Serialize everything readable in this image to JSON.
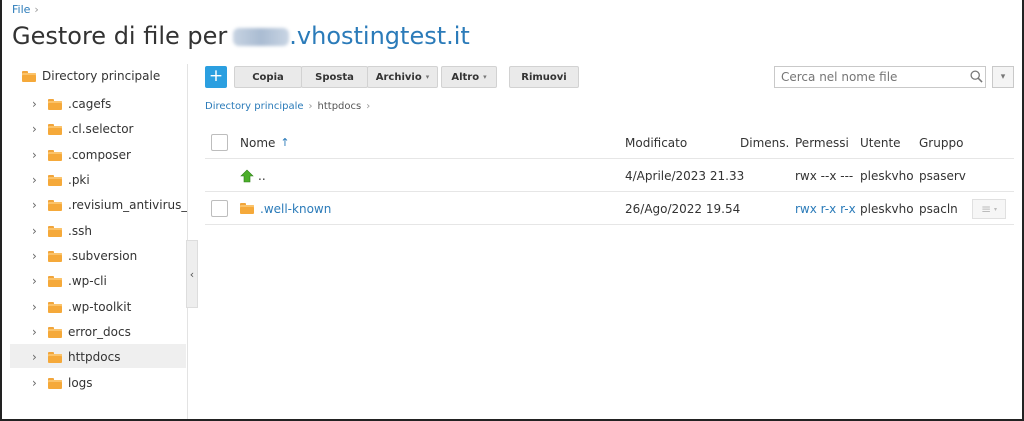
{
  "breadcrumb_top": {
    "label": "File",
    "sep": "›"
  },
  "title": {
    "prefix": "Gestore di file per",
    "domain": ".vhostingtest.it"
  },
  "sidebar": {
    "root": "Directory principale",
    "items": [
      {
        "label": ".cagefs"
      },
      {
        "label": ".cl.selector"
      },
      {
        "label": ".composer"
      },
      {
        "label": ".pki"
      },
      {
        "label": ".revisium_antivirus_cach"
      },
      {
        "label": ".ssh"
      },
      {
        "label": ".subversion"
      },
      {
        "label": ".wp-cli"
      },
      {
        "label": ".wp-toolkit"
      },
      {
        "label": "error_docs"
      },
      {
        "label": "httpdocs"
      },
      {
        "label": "logs"
      }
    ],
    "chevron": "›",
    "collapse": "‹"
  },
  "toolbar": {
    "add": "+",
    "copy": "Copia",
    "move": "Sposta",
    "archive": "Archivio",
    "other": "Altro",
    "remove": "Rimuovi",
    "caret": "▾"
  },
  "search": {
    "placeholder": "Cerca nel nome file",
    "dropdown": "▾"
  },
  "path": {
    "root": "Directory principale",
    "current": "httpdocs",
    "sep": "›"
  },
  "table": {
    "headers": {
      "name": "Nome",
      "sort": "↑",
      "modified": "Modificato",
      "size": "Dimens.",
      "perms": "Permessi",
      "user": "Utente",
      "group": "Gruppo"
    },
    "rows": [
      {
        "name": "..",
        "modified": "4/Aprile/2023 21.33",
        "size": "",
        "perms": "rwx --x ---",
        "user": "pleskvho",
        "group": "psaserv"
      },
      {
        "name": ".well-known",
        "modified": "26/Ago/2022 19.54",
        "size": "",
        "perms": "rwx r-x r-x",
        "user": "pleskvho",
        "group": "psacln",
        "menu": "≡"
      }
    ]
  },
  "colors": {
    "accent": "#2b7bb9",
    "add_button": "#2b9fe0",
    "folder": "#f5a93a",
    "up_arrow": "#4caf2a"
  }
}
